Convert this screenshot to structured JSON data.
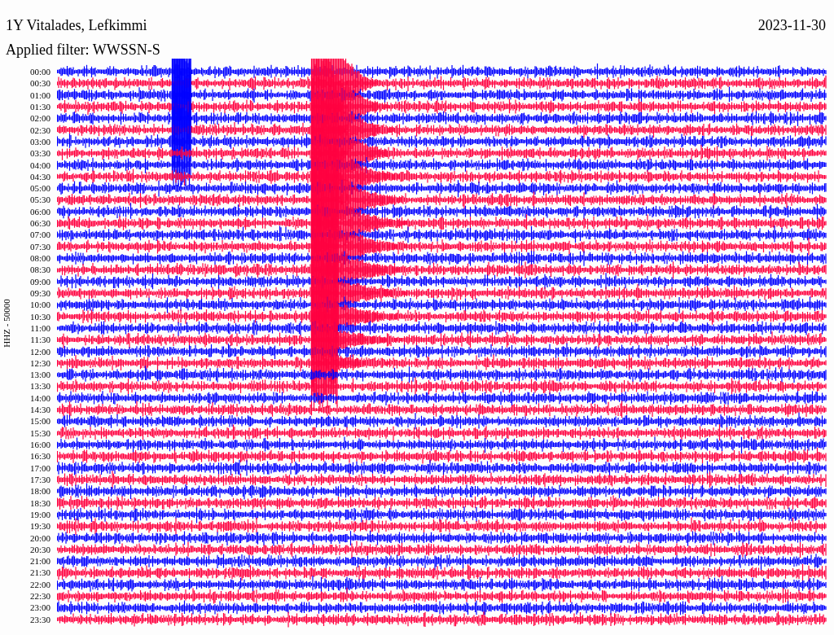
{
  "station": "1Y Vitalades, Lefkimmi",
  "date": "2023-11-30",
  "filter": "Applied filter: WWSSN-S",
  "axis_label": "HHZ - 50000",
  "rows": [
    {
      "time": "00:00",
      "color": "#0000ff"
    },
    {
      "time": "00:30",
      "color": "#ff0040"
    },
    {
      "time": "01:00",
      "color": "#0000ff"
    },
    {
      "time": "01:30",
      "color": "#ff0040"
    },
    {
      "time": "02:00",
      "color": "#0000ff"
    },
    {
      "time": "02:30",
      "color": "#ff0040"
    },
    {
      "time": "03:00",
      "color": "#0000ff"
    },
    {
      "time": "03:30",
      "color": "#ff0040"
    },
    {
      "time": "04:00",
      "color": "#0000ff"
    },
    {
      "time": "04:30",
      "color": "#ff0040"
    },
    {
      "time": "05:00",
      "color": "#0000ff"
    },
    {
      "time": "05:30",
      "color": "#ff0040"
    },
    {
      "time": "06:00",
      "color": "#0000ff"
    },
    {
      "time": "06:30",
      "color": "#ff0040"
    },
    {
      "time": "07:00",
      "color": "#0000ff"
    },
    {
      "time": "07:30",
      "color": "#ff0040"
    },
    {
      "time": "08:00",
      "color": "#0000ff"
    },
    {
      "time": "08:30",
      "color": "#ff0040"
    },
    {
      "time": "09:00",
      "color": "#0000ff"
    },
    {
      "time": "09:30",
      "color": "#ff0040"
    },
    {
      "time": "10:00",
      "color": "#0000ff"
    },
    {
      "time": "10:30",
      "color": "#ff0040"
    },
    {
      "time": "11:00",
      "color": "#0000ff"
    },
    {
      "time": "11:30",
      "color": "#ff0040"
    },
    {
      "time": "12:00",
      "color": "#0000ff"
    },
    {
      "time": "12:30",
      "color": "#ff0040"
    },
    {
      "time": "13:00",
      "color": "#0000ff"
    },
    {
      "time": "13:30",
      "color": "#ff0040"
    },
    {
      "time": "14:00",
      "color": "#0000ff"
    },
    {
      "time": "14:30",
      "color": "#ff0040"
    },
    {
      "time": "15:00",
      "color": "#0000ff"
    },
    {
      "time": "15:30",
      "color": "#ff0040"
    },
    {
      "time": "16:00",
      "color": "#0000ff"
    },
    {
      "time": "16:30",
      "color": "#ff0040"
    },
    {
      "time": "17:00",
      "color": "#0000ff"
    },
    {
      "time": "17:30",
      "color": "#ff0040"
    },
    {
      "time": "18:00",
      "color": "#0000ff"
    },
    {
      "time": "18:30",
      "color": "#ff0040"
    },
    {
      "time": "19:00",
      "color": "#0000ff"
    },
    {
      "time": "19:30",
      "color": "#ff0040"
    },
    {
      "time": "20:00",
      "color": "#0000ff"
    },
    {
      "time": "20:30",
      "color": "#ff0040"
    },
    {
      "time": "21:00",
      "color": "#0000ff"
    },
    {
      "time": "21:30",
      "color": "#ff0040"
    },
    {
      "time": "22:00",
      "color": "#0000ff"
    },
    {
      "time": "22:30",
      "color": "#ff0040"
    },
    {
      "time": "23:00",
      "color": "#0000ff"
    },
    {
      "time": "23:30",
      "color": "#ff0040"
    }
  ]
}
